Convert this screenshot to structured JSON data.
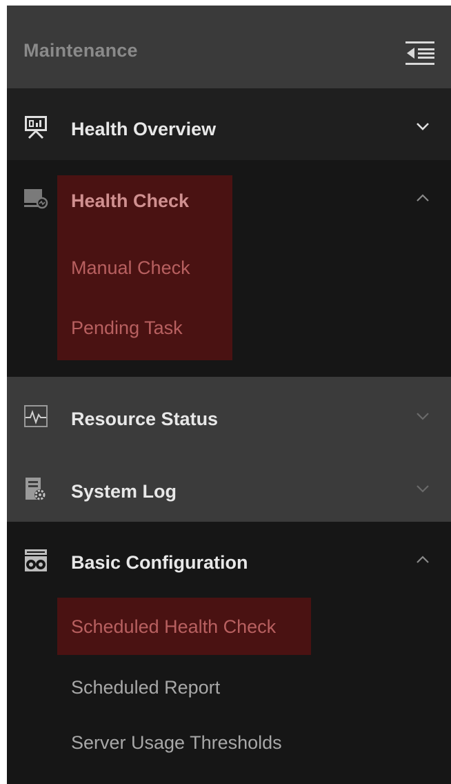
{
  "header": {
    "title": "Maintenance",
    "toggle_icon": "collapse-menu-icon"
  },
  "colors": {
    "sidebar_bg": "#161616",
    "header_bg": "#3a3a3a",
    "overview_bg": "#1f1f1f",
    "group_bg": "#3b3b3b",
    "highlight_bg": "#4a1212",
    "highlight_text": "#b86060",
    "sub_text": "#a8a8a8"
  },
  "sections": [
    {
      "label": "Health Overview",
      "icon": "presentation-chart-icon",
      "state": "collapsed",
      "subitems": []
    },
    {
      "label": "Health Check",
      "icon": "monitor-check-icon",
      "state": "expanded",
      "highlighted": true,
      "subitems": [
        {
          "label": "Manual Check",
          "highlighted": true
        },
        {
          "label": "Pending Task",
          "highlighted": true
        }
      ]
    },
    {
      "label": "Resource Status",
      "icon": "pulse-icon",
      "state": "collapsed",
      "subitems": []
    },
    {
      "label": "System Log",
      "icon": "log-gear-icon",
      "state": "collapsed",
      "subitems": []
    },
    {
      "label": "Basic Configuration",
      "icon": "config-gears-icon",
      "state": "expanded",
      "subitems": [
        {
          "label": "Scheduled Health Check",
          "highlighted": true
        },
        {
          "label": "Scheduled Report",
          "highlighted": false
        },
        {
          "label": "Server Usage Thresholds",
          "highlighted": false
        }
      ]
    }
  ]
}
